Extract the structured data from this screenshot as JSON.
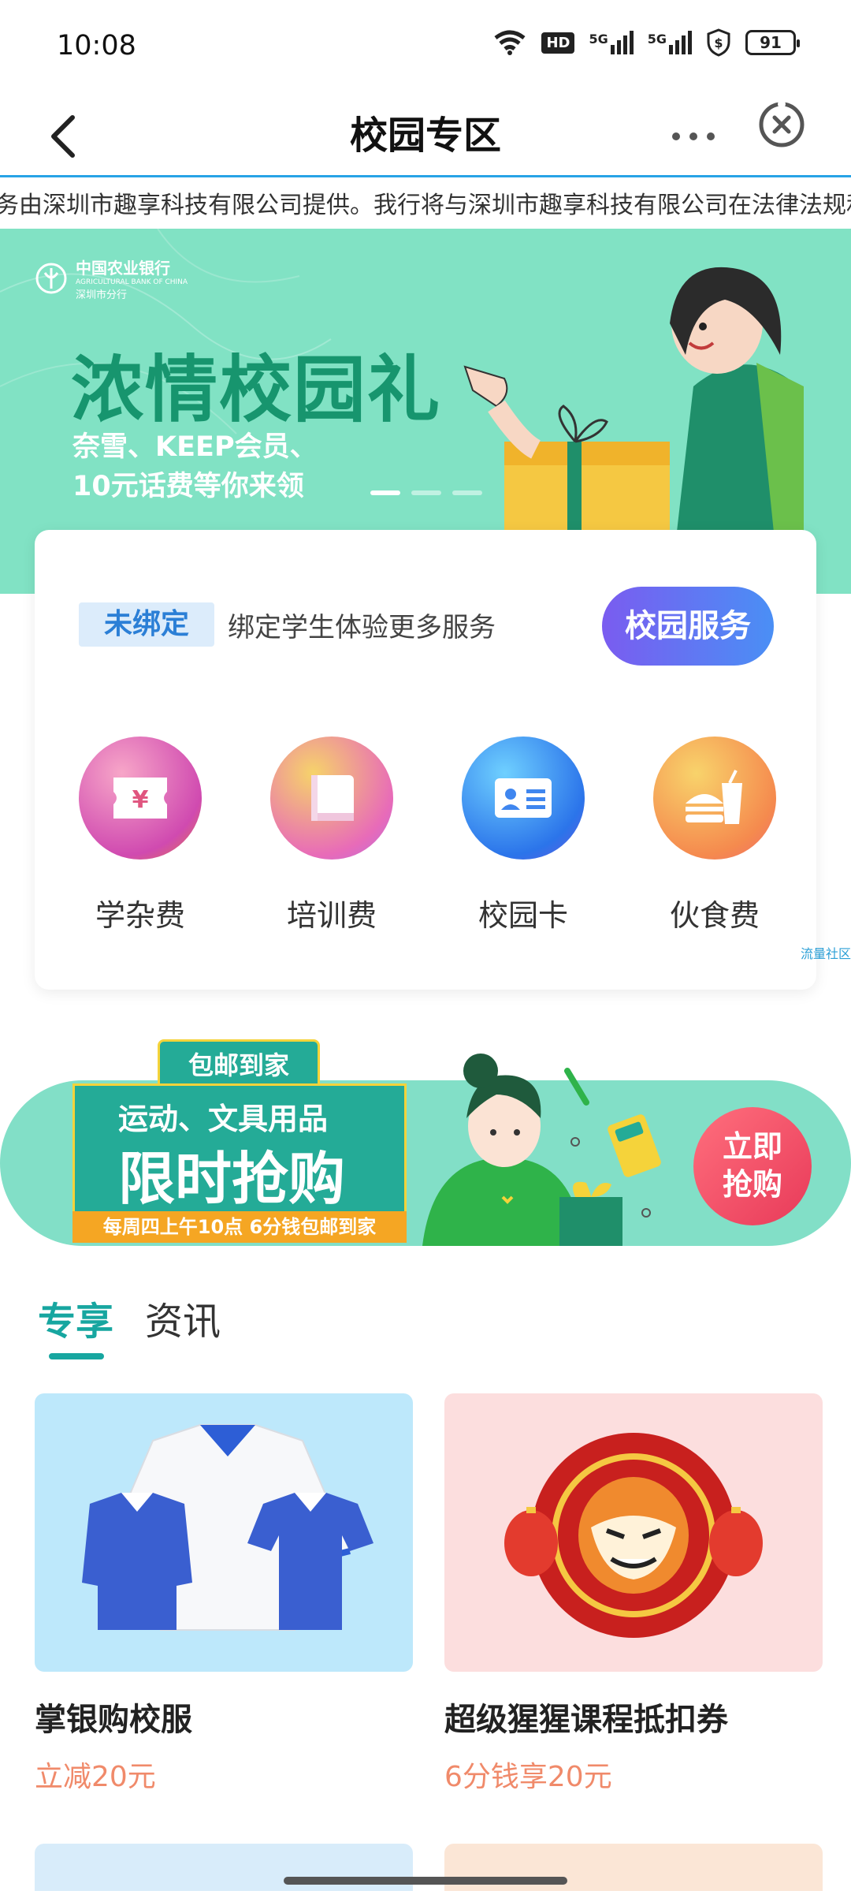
{
  "status_bar": {
    "time": "10:08",
    "signal1": "5G",
    "signal2": "5G",
    "hd": "HD",
    "battery": "91"
  },
  "nav": {
    "title": "校园专区"
  },
  "ticker": {
    "text": "务由深圳市趣享科技有限公司提供。我行将与深圳市趣享科技有限公司在法律法规和合同约"
  },
  "hero": {
    "logo_cn": "中国农业银行",
    "logo_en": "AGRICULTURAL BANK OF CHINA",
    "logo_branch": "深圳市分行",
    "title": "浓情校园礼",
    "subtitle_line1": "奈雪、KEEP会员、",
    "subtitle_line2": "10元话费等你来领"
  },
  "service_card": {
    "badge": "未绑定",
    "bind_text": "绑定学生体验更多服务",
    "campus_service": "校园服务",
    "items": [
      {
        "label": "学杂费",
        "icon": "ticket-yen-icon"
      },
      {
        "label": "培训费",
        "icon": "book-icon"
      },
      {
        "label": "校园卡",
        "icon": "id-card-icon"
      },
      {
        "label": "伙食费",
        "icon": "burger-drink-icon"
      }
    ],
    "watermark": "流量社区"
  },
  "promo": {
    "tag": "包邮到家",
    "line1": "运动、文具用品",
    "line2": "限时抢购",
    "footer": "每周四上午10点 6分钱包邮到家",
    "button_line1": "立即",
    "button_line2": "抢购"
  },
  "tabs": [
    {
      "label": "专享"
    },
    {
      "label": "资讯"
    }
  ],
  "products": [
    {
      "title": "掌银购校服",
      "subtitle": "立减20元"
    },
    {
      "title": "超级猩猩课程抵扣券",
      "subtitle": "6分钱享20元"
    }
  ],
  "colors": {
    "accent": "#17a6a0",
    "hero_bg": "#81e2c4",
    "price": "#f08a6a",
    "button_gradient_start": "#7a5cf0"
  }
}
